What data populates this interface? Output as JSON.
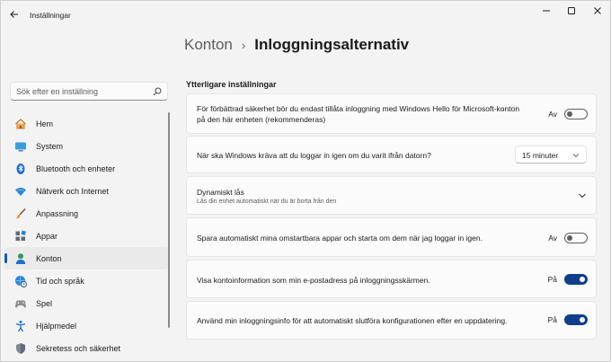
{
  "window": {
    "title": "Inställningar"
  },
  "search": {
    "placeholder": "Sök efter en inställning"
  },
  "sidebar": {
    "items": [
      {
        "label": "Hem",
        "icon": "home-icon"
      },
      {
        "label": "System",
        "icon": "monitor-icon"
      },
      {
        "label": "Bluetooth och enheter",
        "icon": "bluetooth-icon"
      },
      {
        "label": "Nätverk och Internet",
        "icon": "wifi-icon"
      },
      {
        "label": "Anpassning",
        "icon": "brush-icon"
      },
      {
        "label": "Appar",
        "icon": "apps-icon"
      },
      {
        "label": "Konton",
        "icon": "account-icon",
        "active": true
      },
      {
        "label": "Tid och språk",
        "icon": "globe-clock-icon"
      },
      {
        "label": "Spel",
        "icon": "gamepad-icon"
      },
      {
        "label": "Hjälpmedel",
        "icon": "accessibility-icon"
      },
      {
        "label": "Sekretess och säkerhet",
        "icon": "shield-icon"
      }
    ]
  },
  "header": {
    "parent": "Konton",
    "separator": "›",
    "current": "Inloggningsalternativ"
  },
  "section": {
    "title": "Ytterligare inställningar"
  },
  "settings": {
    "hello_only": {
      "text_line1": "För förbättrad säkerhet bör du endast tillåta inloggning med Windows Hello för Microsoft-konton",
      "text_line2": "på den här enheten (rekommenderas)",
      "state": "Av",
      "on": false
    },
    "require_signin": {
      "text": "När ska Windows kräva att du loggar in igen om du varit ifrån datorn?",
      "value": "15 minuter"
    },
    "dynamic_lock": {
      "title": "Dynamiskt lås",
      "subtitle": "Lås din enhet automatiskt när du är borta från den"
    },
    "restart_apps": {
      "text": "Spara automatiskt mina omstartbara appar och starta om dem när jag loggar in igen.",
      "state": "Av",
      "on": false
    },
    "show_account": {
      "text": "Visa kontoinformation som min e-postadress på inloggningsskärmen.",
      "state": "På",
      "on": true
    },
    "auto_finish": {
      "text": "Använd min inloggningsinfo för att automatiskt slutföra konfigurationen efter en uppdatering.",
      "state": "På",
      "on": true
    }
  },
  "colors": {
    "accent": "#0f5cb4",
    "toggle_on": "#0f3f8a",
    "background": "#f3f3f3",
    "card": "#fbfbfb"
  }
}
